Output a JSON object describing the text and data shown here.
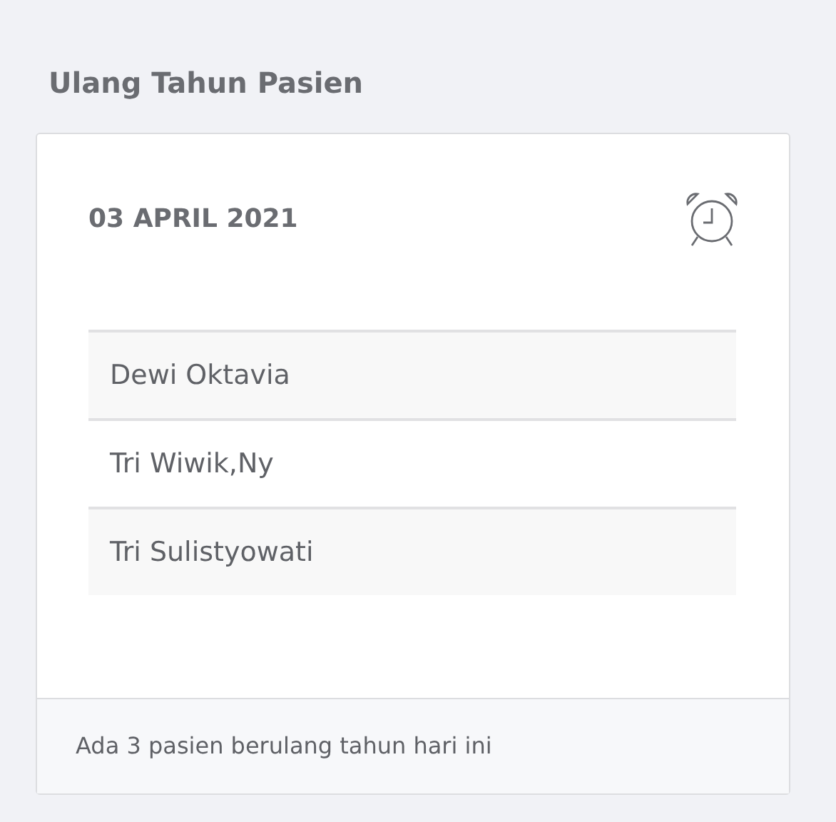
{
  "title": "Ulang Tahun Pasien",
  "card": {
    "date": "03 APRIL 2021",
    "patients": [
      {
        "name": "Dewi Oktavia"
      },
      {
        "name": "Tri Wiwik,Ny"
      },
      {
        "name": "Tri Sulistyowati"
      }
    ],
    "footer": "Ada 3 pasien berulang tahun hari ini"
  }
}
